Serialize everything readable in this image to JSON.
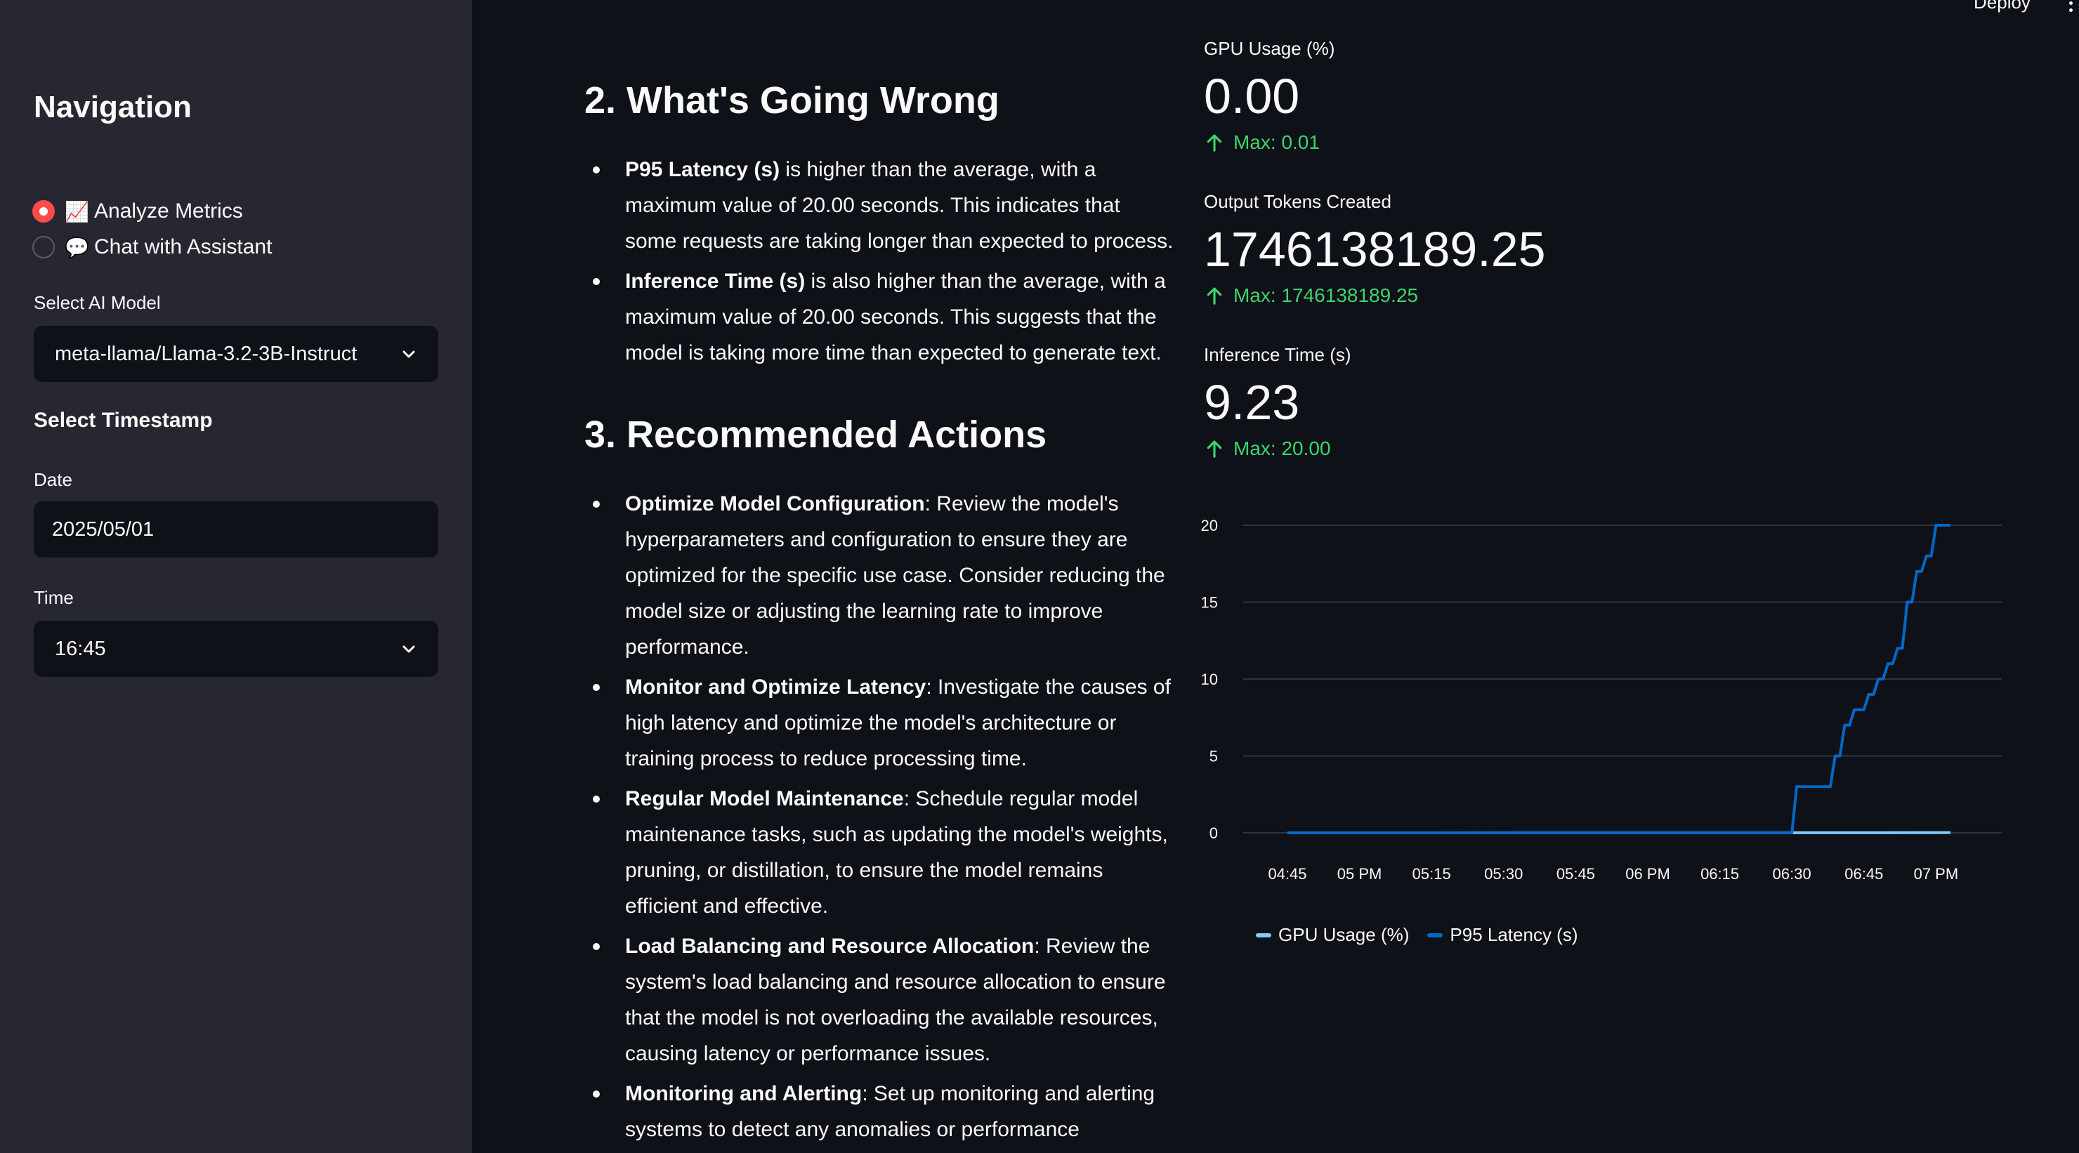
{
  "sidebar": {
    "title": "Navigation",
    "mode_options": [
      {
        "emoji": "📈",
        "label": "Analyze Metrics",
        "selected": true
      },
      {
        "emoji": "💬",
        "label": "Chat with Assistant",
        "selected": false
      }
    ],
    "model_label": "Select AI Model",
    "model_value": "meta-llama/Llama-3.2-3B-Instruct",
    "timestamp_header": "Select Timestamp",
    "date_label": "Date",
    "date_value": "2025/05/01",
    "time_label": "Time",
    "time_value": "16:45"
  },
  "header": {
    "deploy_label": "Deploy"
  },
  "report": {
    "section2_title": "2. What's Going Wrong",
    "section2_items": [
      {
        "bold": "P95 Latency (s)",
        "text": " is higher than the average, with a maximum value of 20.00 seconds. This indicates that some requests are taking longer than expected to process."
      },
      {
        "bold": "Inference Time (s)",
        "text": " is also higher than the average, with a maximum value of 20.00 seconds. This suggests that the model is taking more time than expected to generate text."
      }
    ],
    "section3_title": "3. Recommended Actions",
    "section3_items": [
      {
        "bold": "Optimize Model Configuration",
        "text": ": Review the model's hyperparameters and configuration to ensure they are optimized for the specific use case. Consider reducing the model size or adjusting the learning rate to improve performance."
      },
      {
        "bold": "Monitor and Optimize Latency",
        "text": ": Investigate the causes of high latency and optimize the model's architecture or training process to reduce processing time."
      },
      {
        "bold": "Regular Model Maintenance",
        "text": ": Schedule regular model maintenance tasks, such as updating the model's weights, pruning, or distillation, to ensure the model remains efficient and effective."
      },
      {
        "bold": "Load Balancing and Resource Allocation",
        "text": ": Review the system's load balancing and resource allocation to ensure that the model is not overloading the available resources, causing latency or performance issues."
      },
      {
        "bold": "Monitoring and Alerting",
        "text": ": Set up monitoring and alerting systems to detect any anomalies or performance"
      }
    ]
  },
  "metrics": [
    {
      "label": "GPU Usage (%)",
      "value": "0.00",
      "delta": "Max: 0.01"
    },
    {
      "label": "Output Tokens Created",
      "value": "1746138189.25",
      "delta": "Max: 1746138189.25"
    },
    {
      "label": "Inference Time (s)",
      "value": "9.23",
      "delta": "Max: 20.00"
    }
  ],
  "colors": {
    "accent": "#ff4b4b",
    "delta_positive": "#3dd56d",
    "gpu_series": "#83c9ff",
    "latency_series": "#0068c9"
  },
  "chart_data": {
    "type": "line",
    "x_ticks": [
      "04:45",
      "05 PM",
      "05:15",
      "05:30",
      "05:45",
      "06 PM",
      "06:15",
      "06:30",
      "06:45",
      "07 PM"
    ],
    "y_ticks": [
      "0",
      "5",
      "10",
      "15",
      "20"
    ],
    "ylim": [
      0,
      20
    ],
    "grid": true,
    "legend_position": "bottom-left",
    "series": [
      {
        "name": "GPU Usage (%)",
        "points": [
          [
            "04:45",
            0
          ],
          [
            "07:03",
            0.01
          ]
        ]
      },
      {
        "name": "P95 Latency (s)",
        "points": [
          [
            "04:45",
            0
          ],
          [
            "06:30",
            0
          ],
          [
            "06:31",
            3
          ],
          [
            "06:38",
            3
          ],
          [
            "06:39",
            5
          ],
          [
            "06:40",
            5
          ],
          [
            "06:41",
            7
          ],
          [
            "06:42",
            7
          ],
          [
            "06:43",
            8
          ],
          [
            "06:45",
            8
          ],
          [
            "06:46",
            9
          ],
          [
            "06:47",
            9
          ],
          [
            "06:48",
            10
          ],
          [
            "06:49",
            10
          ],
          [
            "06:50",
            11
          ],
          [
            "06:51",
            11
          ],
          [
            "06:52",
            12
          ],
          [
            "06:53",
            12
          ],
          [
            "06:54",
            15
          ],
          [
            "06:55",
            15
          ],
          [
            "06:56",
            17
          ],
          [
            "06:57",
            17
          ],
          [
            "06:58",
            18
          ],
          [
            "06:59",
            18
          ],
          [
            "07:00",
            20
          ],
          [
            "07:03",
            20
          ]
        ]
      }
    ]
  }
}
